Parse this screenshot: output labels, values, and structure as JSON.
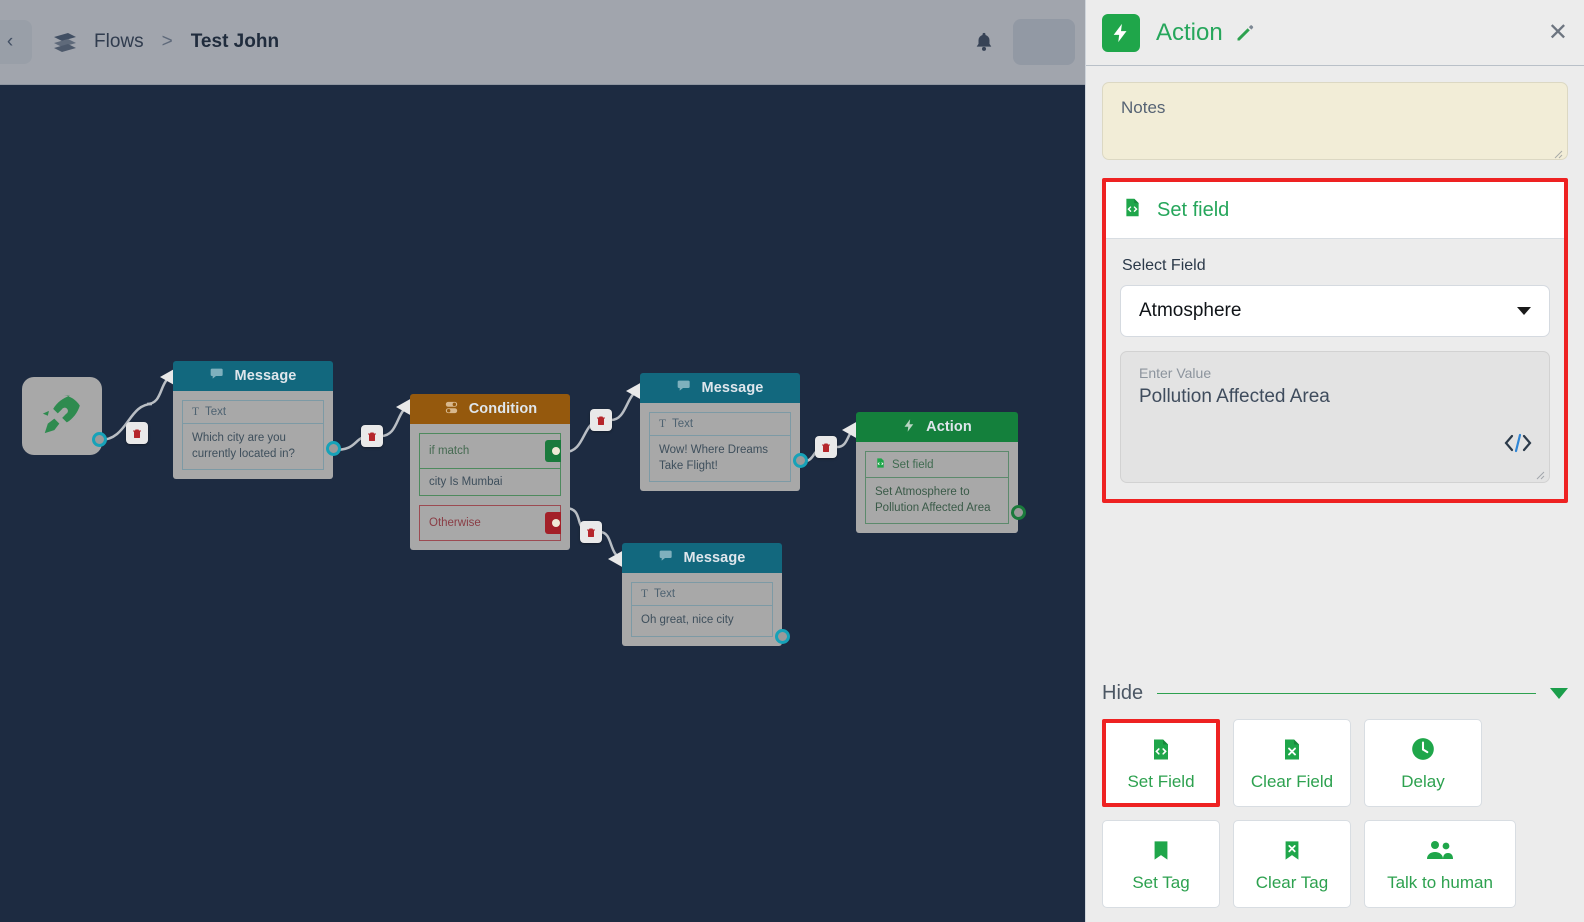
{
  "topbar": {
    "back_icon": "chevron-left-icon",
    "logo_icon": "brand-logo-icon",
    "breadcrumb_root": "Flows",
    "separator": ">",
    "breadcrumb_current": "Test John",
    "bell_icon": "notification-bell-icon"
  },
  "canvas": {
    "start_node": {
      "icon": "rocket-icon"
    },
    "nodes": [
      {
        "type": "Message",
        "title": "Message",
        "icon": "message-icon",
        "slot_label": "Text",
        "slot_label_icon": "text-T-icon",
        "text": "Which city are you currently located in?"
      },
      {
        "type": "Condition",
        "title": "Condition",
        "icon": "toggle-icon",
        "if_label": "if match",
        "if_value": "city Is Mumbai",
        "otherwise_label": "Otherwise"
      },
      {
        "type": "Message",
        "title": "Message",
        "icon": "message-icon",
        "slot_label": "Text",
        "slot_label_icon": "text-T-icon",
        "text": "Wow! Where Dreams Take Flight!"
      },
      {
        "type": "Message",
        "title": "Message",
        "icon": "message-icon",
        "slot_label": "Text",
        "slot_label_icon": "text-T-icon",
        "text": "Oh great, nice city"
      },
      {
        "type": "Action",
        "title": "Action",
        "icon": "action-bolt-icon",
        "slot_label": "Set field",
        "slot_label_icon": "set-field-icon",
        "text": "Set Atmosphere to Pollution Affected Area"
      }
    ],
    "delete_icon": "trash-icon"
  },
  "panel": {
    "icon": "action-bolt-icon",
    "title": "Action",
    "edit_icon": "pencil-icon",
    "close_icon": "close-icon",
    "notes_placeholder": "Notes",
    "notes_value": "",
    "resize_icon": "resize-grip-icon",
    "set_field": {
      "icon": "set-field-icon",
      "header": "Set field",
      "select_label": "Select Field",
      "selected_field": "Atmosphere",
      "dropdown_icon": "chevron-down-icon",
      "value_placeholder": "Enter Value",
      "value_text": "Pollution Affected Area",
      "code_icon": "code-brackets-icon",
      "resize_icon": "resize-grip-icon"
    },
    "footer": {
      "hide_label": "Hide",
      "collapse_icon": "caret-down-icon",
      "actions": [
        {
          "label": "Set Field",
          "icon": "set-field-icon",
          "selected": true
        },
        {
          "label": "Clear Field",
          "icon": "clear-field-icon",
          "selected": false
        },
        {
          "label": "Delay",
          "icon": "clock-icon",
          "selected": false
        },
        {
          "label": "Set Tag",
          "icon": "bookmark-icon",
          "selected": false
        },
        {
          "label": "Clear Tag",
          "icon": "clear-tag-icon",
          "selected": false
        },
        {
          "label": "Talk to human",
          "icon": "people-icon",
          "selected": false
        }
      ]
    }
  },
  "colors": {
    "accent_green": "#26a65b",
    "highlight_red": "#ee2222",
    "canvas_bg": "#1d2b41",
    "message_head": "#12687e",
    "condition_head": "#95590d",
    "action_head": "#14803c",
    "notes_bg": "#f2edd7"
  }
}
